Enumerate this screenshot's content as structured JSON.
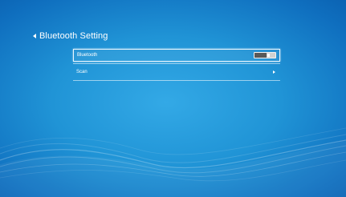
{
  "header": {
    "title": "Bluetooth Setting",
    "back_icon": "chevron-left-icon"
  },
  "menu": {
    "items": [
      {
        "label": "Bluetooth",
        "control": "toggle",
        "state": "on",
        "selected": true
      },
      {
        "label": "Scan",
        "control": "chevron",
        "selected": false
      }
    ]
  },
  "colors": {
    "background_center": "#33a9e6",
    "background_edge": "#0b63b3",
    "text": "#ffffff",
    "selection_border": "#e9f6ff"
  }
}
